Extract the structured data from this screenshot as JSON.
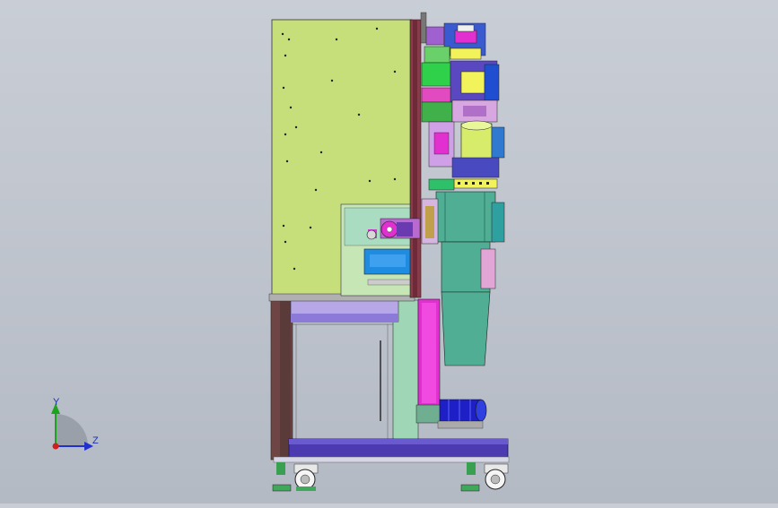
{
  "viewport": {
    "background_top": "#c9ced6",
    "background_bottom": "#b4bac4"
  },
  "triad": {
    "y_label": "Y",
    "z_label": "Z",
    "colors": {
      "y": "#1fa31f",
      "z": "#1f2fd0",
      "x": "#d01f1f",
      "sector": "#9aa0aa"
    }
  },
  "model": {
    "panel_color": "#c6df7a",
    "frame_color": "#5b3a3a",
    "base_color": "#4b3ab0",
    "drum_color": "#4fae94",
    "motor_color": "#1f1fc8",
    "accent_magenta": "#e22fd0",
    "accent_yellow": "#f2f25a"
  }
}
